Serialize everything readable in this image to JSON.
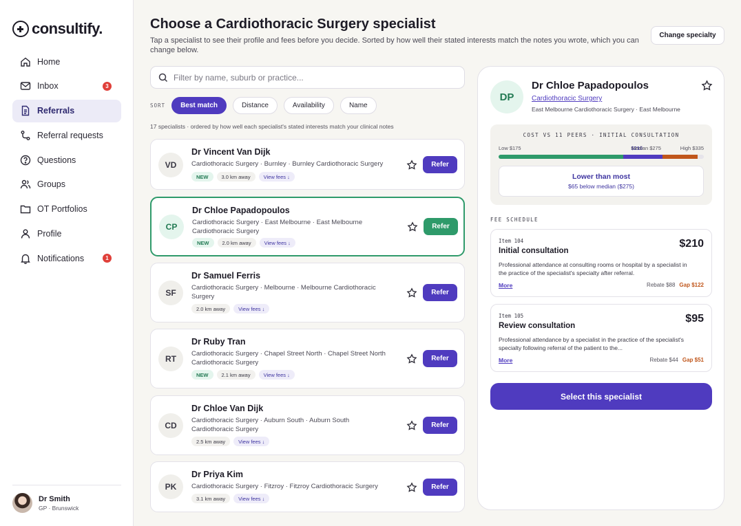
{
  "app": {
    "name": "consultify."
  },
  "nav": {
    "items": [
      {
        "label": "Home",
        "icon": "home-icon"
      },
      {
        "label": "Inbox",
        "icon": "mail-icon",
        "badge": "3"
      },
      {
        "label": "Referrals",
        "icon": "document-icon",
        "active": true
      },
      {
        "label": "Referral requests",
        "icon": "route-icon"
      },
      {
        "label": "Questions",
        "icon": "question-icon"
      },
      {
        "label": "Groups",
        "icon": "users-icon"
      },
      {
        "label": "OT Portfolios",
        "icon": "folder-icon"
      },
      {
        "label": "Profile",
        "icon": "person-icon"
      },
      {
        "label": "Notifications",
        "icon": "bell-icon",
        "badge": "1"
      }
    ]
  },
  "user": {
    "name": "Dr Smith",
    "subtitle": "GP · Brunswick"
  },
  "header": {
    "title": "Choose a Cardiothoracic Surgery specialist",
    "description": "Tap a specialist to see their profile and fees before you decide. Sorted by how well their stated interests match the notes you wrote, which you can change below.",
    "change_button": "Change specialty"
  },
  "search": {
    "placeholder": "Filter by name, suburb or practice..."
  },
  "sort": {
    "label": "SORT",
    "options": [
      "Best match",
      "Distance",
      "Availability",
      "Name"
    ],
    "selected": "Best match"
  },
  "results_summary": "17 specialists · ordered by how well each specialist's stated interests match your clinical notes",
  "specialists": [
    {
      "initials": "VD",
      "name": "Dr Vincent Van Dijk",
      "specialty": "Cardiothoracic Surgery · Burnley · Burnley Cardiothoracic Surgery",
      "new": "NEW",
      "distance": "3.0 km away",
      "fees": "View fees ↓",
      "refer": "Refer"
    },
    {
      "initials": "CP",
      "name": "Dr Chloe Papadopoulos",
      "specialty": "Cardiothoracic Surgery · East Melbourne · East Melbourne Cardiothoracic Surgery",
      "new": "NEW",
      "distance": "2.0 km away",
      "fees": "View fees ↓",
      "refer": "Refer",
      "selected": true
    },
    {
      "initials": "SF",
      "name": "Dr Samuel Ferris",
      "specialty": "Cardiothoracic Surgery · Melbourne · Melbourne Cardiothoracic Surgery",
      "new": "",
      "distance": "2.0 km away",
      "fees": "View fees ↓",
      "refer": "Refer"
    },
    {
      "initials": "RT",
      "name": "Dr Ruby Tran",
      "specialty": "Cardiothoracic Surgery · Chapel Street North · Chapel Street North Cardiothoracic Surgery",
      "new": "NEW",
      "distance": "2.1 km away",
      "fees": "View fees ↓",
      "refer": "Refer"
    },
    {
      "initials": "CD",
      "name": "Dr Chloe Van Dijk",
      "specialty": "Cardiothoracic Surgery · Auburn South · Auburn South Cardiothoracic Surgery",
      "new": "",
      "distance": "2.5 km away",
      "fees": "View fees ↓",
      "refer": "Refer"
    },
    {
      "initials": "PK",
      "name": "Dr Priya Kim",
      "specialty": "Cardiothoracic Surgery · Fitzroy · Fitzroy Cardiothoracic Surgery",
      "new": "",
      "distance": "3.1 km away",
      "fees": "View fees ↓",
      "refer": "Refer"
    }
  ],
  "detail": {
    "initials": "DP",
    "name": "Dr Chloe Papadopoulos",
    "specialty": "Cardiothoracic Surgery",
    "location": "East Melbourne Cardiothoracic Surgery · East Melbourne",
    "cost": {
      "title": "COST VS 11 PEERS · INITIAL CONSULTATION",
      "low": "Low $175",
      "this": "$210",
      "median": "Median $275",
      "high": "High $335",
      "low_value": 175,
      "this_value": 210,
      "median_value": 275,
      "high_value": 335,
      "comparison": "Lower than most",
      "comparison_detail": "$65 below median ($275)",
      "colors": {
        "low": "#2e9a6a",
        "mid": "#4f3bbf",
        "high": "#c0561b",
        "rest": "#e6e4ea"
      }
    },
    "fee_heading": "FEE SCHEDULE",
    "fees": [
      {
        "item": "Item 104",
        "name": "Initial consultation",
        "price": "$210",
        "description": "Professional attendance at consulting rooms or hospital by a specialist in the practice of the specialist's specialty after referral.",
        "more": "More",
        "rebate": "Rebate $88",
        "gap": "Gap $122"
      },
      {
        "item": "Item 105",
        "name": "Review consultation",
        "price": "$95",
        "description": "Professional attendance by a specialist in the practice of the specialist's specialty following referral of the patient to the...",
        "more": "More",
        "rebate": "Rebate $44",
        "gap": "Gap $51"
      }
    ],
    "select_button": "Select this specialist"
  }
}
